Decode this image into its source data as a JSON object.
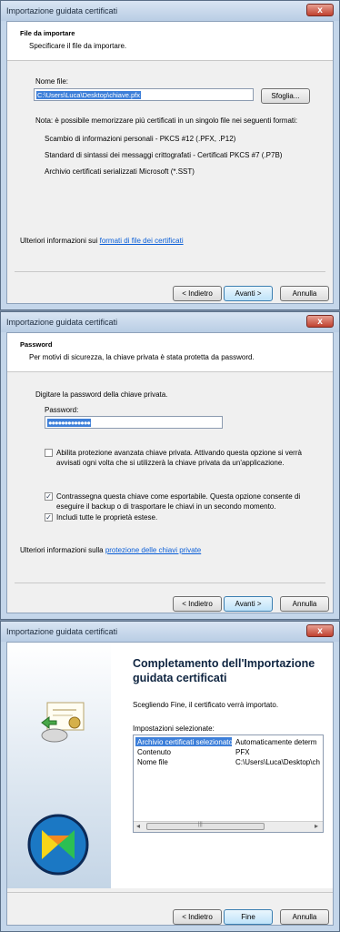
{
  "window": {
    "title": "Importazione guidata certificati",
    "close_label": "x"
  },
  "dialog1": {
    "header_title": "File da importare",
    "header_subtitle": "Specificare il file da importare.",
    "file_name_label": "Nome file:",
    "file_name_value": "C:\\Users\\Luca\\Desktop\\chiave.pfx",
    "browse_label": "Sfoglia...",
    "note": "Nota: è possibile memorizzare più certificati in un singolo file nei seguenti formati:",
    "formats": [
      "Scambio di informazioni personali - PKCS #12 (.PFX, .P12)",
      "Standard di sintassi dei messaggi crittografati - Certificati PKCS #7 (.P7B)",
      "Archivio certificati serializzati Microsoft (*.SST)"
    ],
    "more_info_prefix": "Ulteriori informazioni sui ",
    "more_info_link": "formati di file dei certificati",
    "back": "< Indietro",
    "next": "Avanti >",
    "cancel": "Annulla"
  },
  "dialog2": {
    "header_title": "Password",
    "header_subtitle": "Per motivi di sicurezza, la chiave privata è stata protetta da password.",
    "prompt": "Digitare la password della chiave privata.",
    "password_label": "Password:",
    "password_value": "●●●●●●●●●●●●●",
    "option1_line1": "Abilita protezione avanzata chiave privata. Attivando questa opzione si verrà",
    "option1_line2": "avvisati ogni volta che si utilizzerà la chiave privata da un'applicazione.",
    "option2_line1": "Contrassegna questa chiave come esportabile. Questa opzione consente di",
    "option2_line2": "eseguire il backup o di trasportare le chiavi in un secondo momento.",
    "option3": "Includi tutte le proprietà estese.",
    "check_mark": "✓",
    "more_info_prefix": "Ulteriori informazioni sulla ",
    "more_info_link": "protezione delle chiavi private",
    "back": "< Indietro",
    "next": "Avanti >",
    "cancel": "Annulla"
  },
  "dialog3": {
    "heading_line1": "Completamento dell'Importazione",
    "heading_line2": "guidata certificati",
    "info": "Scegliendo Fine, il certificato verrà importato.",
    "settings_label": "Impostazioni selezionate:",
    "settings": [
      {
        "key": "Archivio certificati selezionato",
        "value": "Automaticamente determ"
      },
      {
        "key": "Contenuto",
        "value": "PFX"
      },
      {
        "key": "Nome file",
        "value": "C:\\Users\\Luca\\Desktop\\ch"
      }
    ],
    "scroll_left": "◂",
    "scroll_right": "▸",
    "scroll_thumb": "|||",
    "back": "< Indietro",
    "finish": "Fine",
    "cancel": "Annulla"
  },
  "colors": {
    "selection": "#3d7fd9",
    "link": "#0a5ed7",
    "close": "#c0412f"
  }
}
